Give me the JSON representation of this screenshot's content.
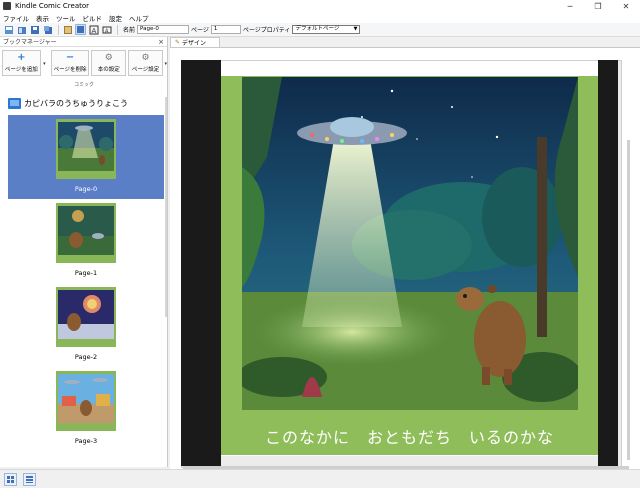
{
  "window": {
    "title": "Kindle Comic Creator",
    "controls": [
      "minimize",
      "maximize",
      "close"
    ]
  },
  "menu": [
    "ファイル",
    "表示",
    "ツール",
    "ビルド",
    "設定",
    "ヘルプ"
  ],
  "toolbar": {
    "name_label": "名前",
    "name_value": "Page-0",
    "page_label": "ページ",
    "page_value": "1",
    "props_label": "ページプロパティ",
    "props_value": "デフォルトページ"
  },
  "panel": {
    "title": "ブックマネージャー",
    "close": "×",
    "add_page": "ページを追加",
    "delete_page": "ページを削除",
    "book_settings": "本の設定",
    "page_settings": "ページ設定",
    "group_label": "コミック",
    "book_title": "カピバラのうちゅうりょこう",
    "pages": [
      {
        "label": "Page-0",
        "selected": true
      },
      {
        "label": "Page-1",
        "selected": false
      },
      {
        "label": "Page-2",
        "selected": false
      },
      {
        "label": "Page-3",
        "selected": false
      }
    ]
  },
  "design_tab": "デザイン",
  "page_caption": "このなかに　おともだち　いるのかな",
  "colors": {
    "green_bg": "#8fbd5a",
    "selection": "#5b7fc7",
    "accent": "#2b7bd6"
  }
}
